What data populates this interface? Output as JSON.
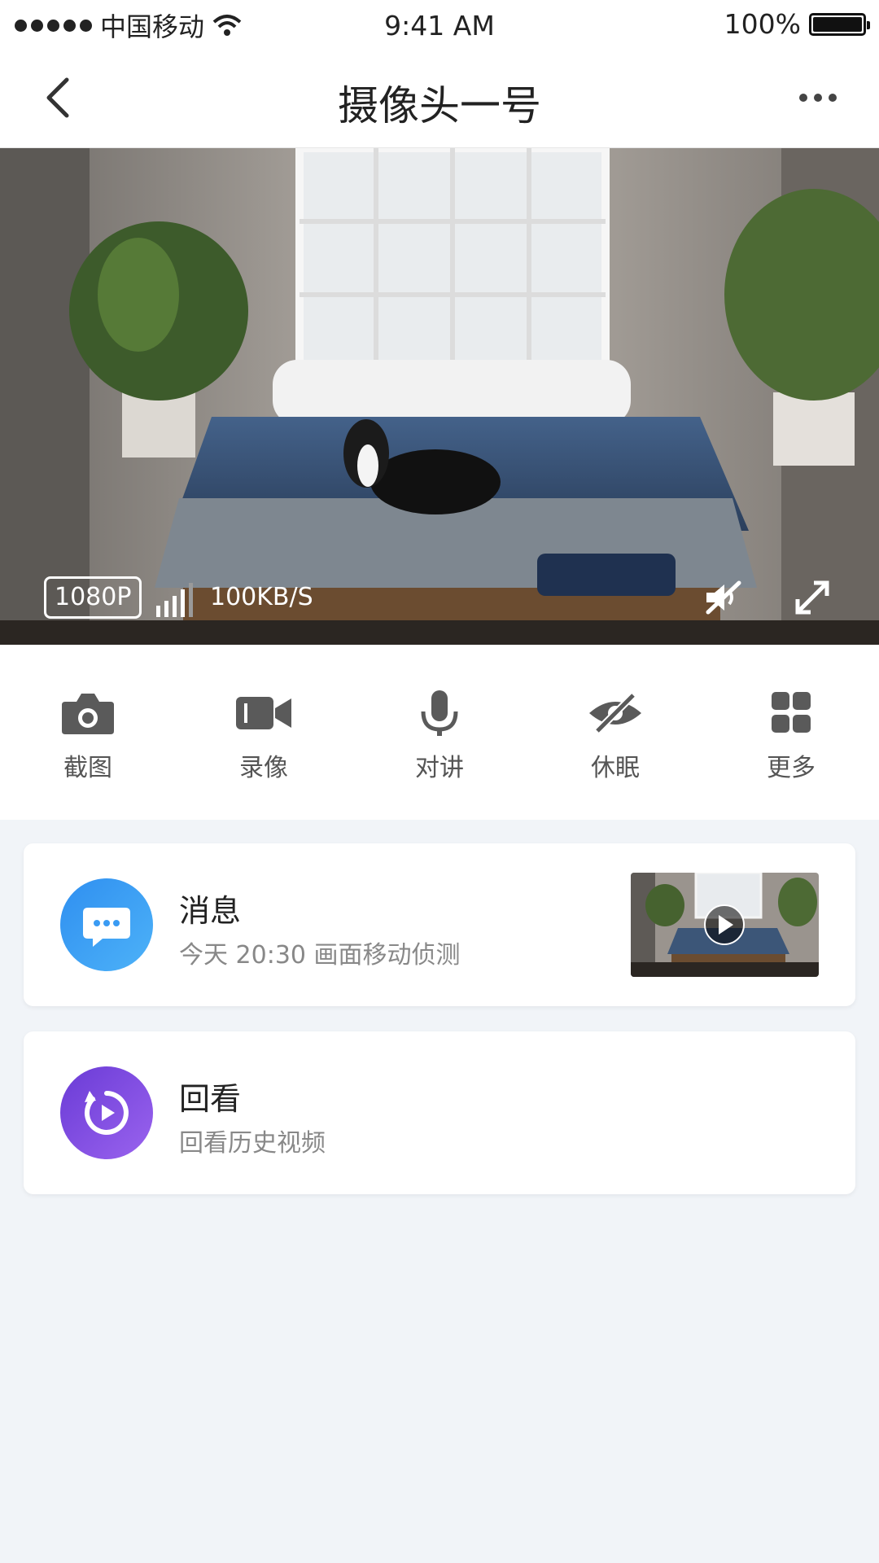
{
  "status_bar": {
    "carrier": "中国移动",
    "time": "9:41 AM",
    "battery": "100%"
  },
  "nav": {
    "title": "摄像头一号",
    "back_icon": "back-chevron-icon",
    "more_icon": "more-dots-icon"
  },
  "video": {
    "resolution": "1080P",
    "speed": "100KB/S"
  },
  "controls": [
    {
      "label": "截图",
      "icon": "camera-icon"
    },
    {
      "label": "录像",
      "icon": "video-camera-icon"
    },
    {
      "label": "对讲",
      "icon": "microphone-icon"
    },
    {
      "label": "休眠",
      "icon": "eye-off-icon"
    },
    {
      "label": "更多",
      "icon": "grid-icon"
    }
  ],
  "message_card": {
    "title": "消息",
    "subtitle": "今天 20:30 画面移动侦测"
  },
  "playback_card": {
    "title": "回看",
    "subtitle": "回看历史视频"
  },
  "colors": {
    "background": "#f1f4f8",
    "message_accent": "#2f8ff0",
    "playback_accent": "#7b4ae2"
  }
}
